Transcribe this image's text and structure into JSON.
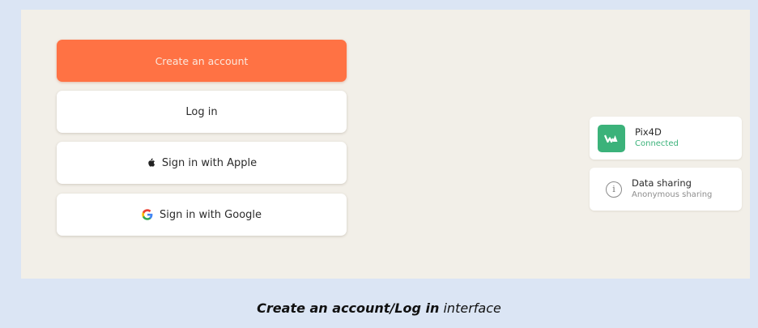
{
  "auth": {
    "create_account_label": "Create an account",
    "login_label": "Log in",
    "apple_label": "Sign in with Apple",
    "google_label": "Sign in with Google"
  },
  "integrations": {
    "pix4d": {
      "name": "Pix4D",
      "status": "Connected",
      "icon": "pix4d-logo-icon",
      "accent": "#3bb27a"
    },
    "data_sharing": {
      "title": "Data sharing",
      "subtitle": "Anonymous sharing",
      "icon": "info-icon"
    }
  },
  "caption": {
    "emphasis": "Create an account/Log in",
    "rest": "interface"
  },
  "colors": {
    "primary_button": "#ff7244",
    "screen_background": "#f2efe8",
    "page_background": "#dbe5f4"
  }
}
